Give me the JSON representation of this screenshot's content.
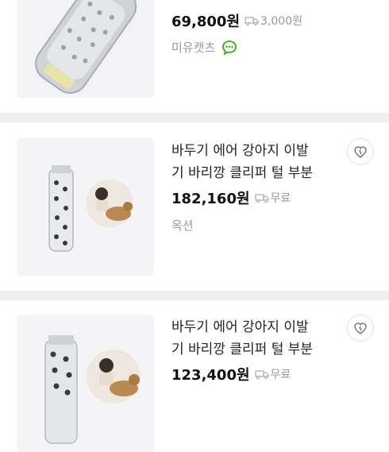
{
  "products": [
    {
      "title": "",
      "price": "69,800원",
      "shipping": "3,000원",
      "seller": "미유캣츠",
      "has_talk_icon": true
    },
    {
      "title_line1": "바두기 에어 강아지 이발",
      "title_line2": "기 바리깡 클리퍼 털 부분",
      "price": "182,160원",
      "shipping": "무료",
      "seller": "옥션"
    },
    {
      "title_line1": "바두기 에어 강아지 이발",
      "title_line2": "기 바리깡 클리퍼 털 부분",
      "price": "123,400원",
      "shipping": "무료"
    }
  ],
  "icons": {
    "shipping": "truck-icon",
    "talk": "talk-icon",
    "heart": "heart-icon"
  },
  "colors": {
    "talk_green": "#2db400",
    "separator": "#eeeff1"
  }
}
